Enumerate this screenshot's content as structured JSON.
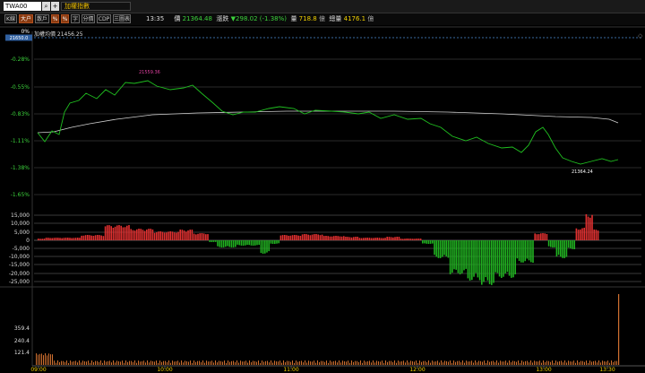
{
  "header": {
    "symbol": "TWA00",
    "name": "加權指數",
    "search_icon": "magnifier-icon",
    "add_icon": "plus-icon"
  },
  "toolbar": {
    "buttons": [
      "K線",
      "大户",
      "散戶",
      "%",
      "%",
      "字",
      "分價",
      "CDP",
      "三圖表"
    ],
    "active": [
      1,
      3,
      4
    ]
  },
  "quote": {
    "time": "13:35",
    "price_label": "價",
    "price": "21364.48",
    "change_label": "漲跌",
    "change": "▼298.02 (-1.38%)",
    "volume_label": "量",
    "volume": "718.8",
    "volume_unit": "億",
    "total_label": "總量",
    "total": "4176.1",
    "total_unit": "億"
  },
  "price_chart": {
    "ref_tag": "21650.0",
    "ref_pct": "0%",
    "name_label": "加權均價 21456.25",
    "y_labels": [
      "-0.28%",
      "-0.55%",
      "-0.83%",
      "-1.11%",
      "-1.38%",
      "-1.65%"
    ],
    "high_label": "21559.36",
    "low_label": "21364.24"
  },
  "diff_chart": {
    "y_labels": [
      "15,000",
      "10,000",
      "5,000",
      "0",
      "-5,000",
      "-10,000",
      "-15,000",
      "-20,000",
      "-25,000"
    ]
  },
  "volume_chart": {
    "y_labels": [
      "359.4",
      "240.4",
      "121.4"
    ]
  },
  "time_axis": [
    "09:00",
    "10:00",
    "11:00",
    "12:00",
    "13:00",
    "13:30"
  ],
  "colors": {
    "up": "#e03030",
    "down": "#20b020",
    "price_line": "#20c020",
    "avg_line": "#d0d0d0",
    "high": "#e040a0"
  }
}
